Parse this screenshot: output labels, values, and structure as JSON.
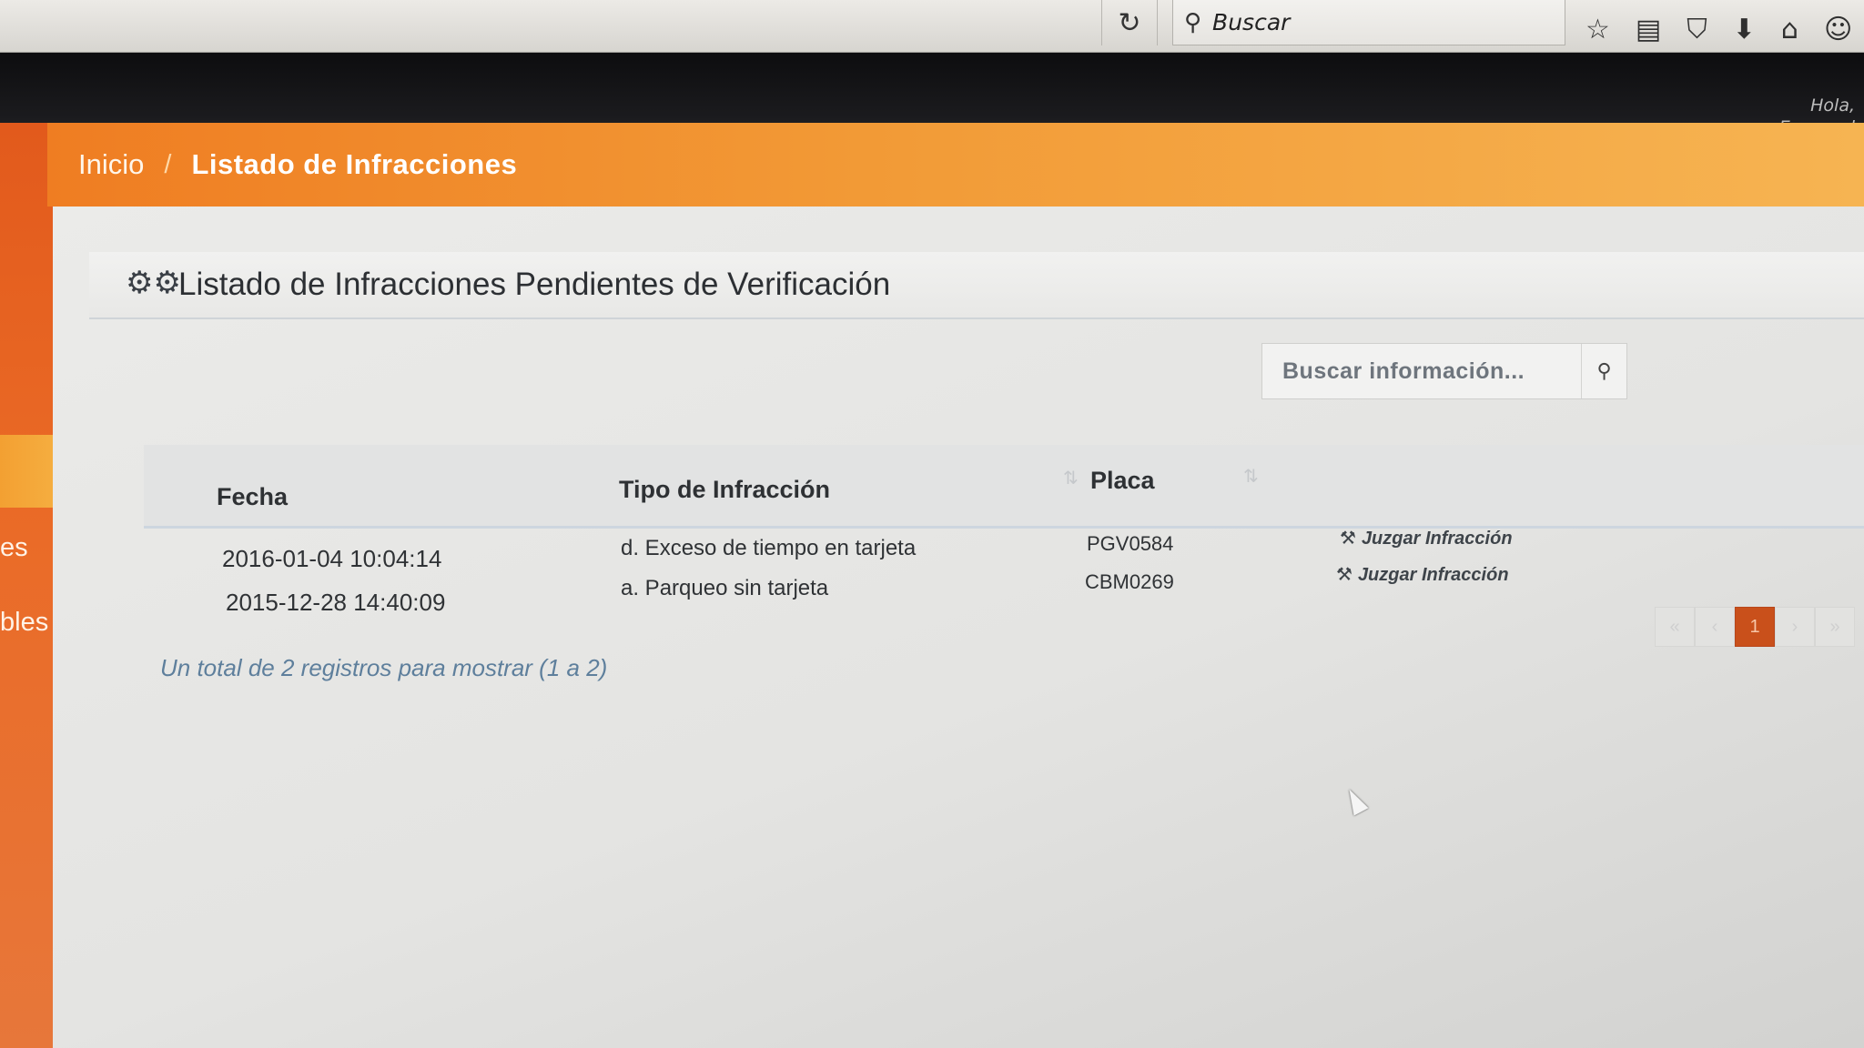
{
  "browser": {
    "reload_icon": "reload-icon",
    "search_placeholder": "Buscar",
    "toolbar_icons": [
      "star-icon",
      "clipboard-icon",
      "pocket-icon",
      "download-icon",
      "home-icon",
      "chat-icon"
    ]
  },
  "user": {
    "greeting_line1": "Hola,",
    "greeting_line2": "Emanuel"
  },
  "sidebar": {
    "items": [
      {
        "label": "es"
      },
      {
        "label": "bles"
      }
    ],
    "accent_color": "#e8641f"
  },
  "breadcrumb": {
    "items": [
      {
        "label": "Inicio"
      },
      {
        "label": "Listado de Infracciones"
      }
    ],
    "separator": "/"
  },
  "panel": {
    "title": "Listado de Infracciones Pendientes de Verificación",
    "icon": "gears-icon"
  },
  "search": {
    "placeholder": "Buscar información...",
    "icon": "search-icon"
  },
  "table": {
    "columns": [
      "Fecha",
      "Tipo de Infracción",
      "Placa"
    ],
    "rows": [
      {
        "fecha": "2016-01-04 10:04:14",
        "tipo": "d. Exceso de tiempo en tarjeta",
        "placa": "PGV0584",
        "action": "Juzgar Infracción"
      },
      {
        "fecha": "2015-12-28 14:40:09",
        "tipo": "a. Parqueo sin tarjeta",
        "placa": "CBM0269",
        "action": "Juzgar Infracción"
      }
    ]
  },
  "summary": "Un total de 2 registros para mostrar (1 a 2)",
  "pagination": {
    "pages": [
      "«",
      "‹",
      "1",
      "›",
      "»"
    ],
    "current": "1",
    "active_color": "#c9501b"
  }
}
